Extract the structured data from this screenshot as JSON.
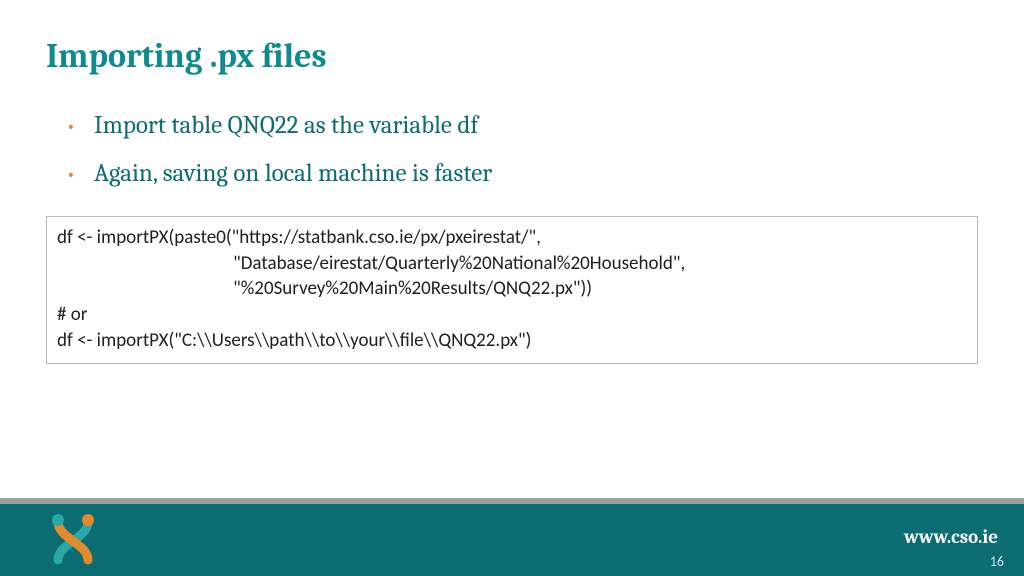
{
  "title": "Importing .px files",
  "bullets": [
    "Import table QNQ22 as the variable df",
    "Again, saving on local machine is faster"
  ],
  "code": "df <- importPX(paste0(\"https://statbank.cso.ie/px/pxeirestat/\",\n                                         \"Database/eirestat/Quarterly%20National%20Household\",\n                                         \"%20Survey%20Main%20Results/QNQ22.px\"))\n# or\ndf <- importPX(\"C:\\\\Users\\\\path\\\\to\\\\your\\\\file\\\\QNQ22.px\")",
  "footer": {
    "url": "www.cso.ie",
    "page": "16"
  }
}
